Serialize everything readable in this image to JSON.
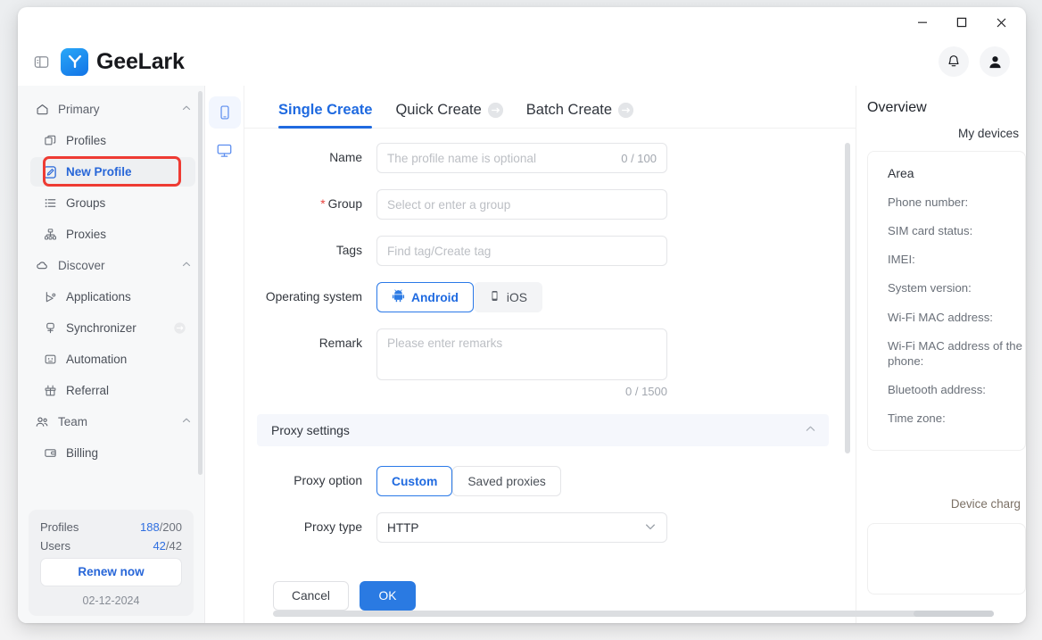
{
  "window": {
    "controls": {
      "minimize": "minimize-icon",
      "maximize": "maximize-icon",
      "close": "close-icon"
    }
  },
  "header": {
    "panel_toggle": "panel-toggle-icon",
    "brand_name": "GeeLark",
    "notification_icon": "bell-icon",
    "account_icon": "user-avatar-icon"
  },
  "sidebar": {
    "groups": [
      {
        "label": "Primary",
        "icon": "home-icon",
        "items": [
          {
            "label": "Profiles",
            "icon": "profiles-icon",
            "active": false
          },
          {
            "label": "New Profile",
            "icon": "edit-square-icon",
            "active": true
          },
          {
            "label": "Groups",
            "icon": "list-icon",
            "active": false
          },
          {
            "label": "Proxies",
            "icon": "network-icon",
            "active": false
          }
        ]
      },
      {
        "label": "Discover",
        "icon": "cloud-icon",
        "items": [
          {
            "label": "Applications",
            "icon": "apps-icon",
            "active": false
          },
          {
            "label": "Synchronizer",
            "icon": "sync-icon",
            "active": false,
            "badge": "link-badge-icon"
          },
          {
            "label": "Automation",
            "icon": "automation-icon",
            "active": false
          },
          {
            "label": "Referral",
            "icon": "gift-icon",
            "active": false
          }
        ]
      },
      {
        "label": "Team",
        "icon": "team-icon",
        "items": [
          {
            "label": "Billing",
            "icon": "billing-icon",
            "active": false
          }
        ]
      }
    ],
    "quota": {
      "profiles_label": "Profiles",
      "profiles_used": "188",
      "profiles_total": "/200",
      "users_label": "Users",
      "users_used": "42",
      "users_total": "/42",
      "renew_label": "Renew now",
      "date": "02-12-2024"
    }
  },
  "rail": {
    "items": [
      {
        "icon": "phone-icon",
        "active": true
      },
      {
        "icon": "monitor-icon",
        "active": false
      }
    ]
  },
  "main": {
    "tabs": [
      {
        "label": "Single Create",
        "active": true,
        "badge": null
      },
      {
        "label": "Quick Create",
        "active": false,
        "badge": "link-badge-icon"
      },
      {
        "label": "Batch Create",
        "active": false,
        "badge": "link-badge-icon"
      }
    ],
    "form": {
      "name": {
        "label": "Name",
        "placeholder": "The profile name is optional",
        "value": "",
        "counter": "0 / 100"
      },
      "group": {
        "label": "Group",
        "required": true,
        "placeholder": "Select or enter a group",
        "value": ""
      },
      "tags": {
        "label": "Tags",
        "placeholder": "Find tag/Create tag",
        "value": ""
      },
      "operating_system": {
        "label": "Operating system",
        "options": [
          {
            "label": "Android",
            "icon": "android-icon",
            "selected": true
          },
          {
            "label": "iOS",
            "icon": "ios-phone-icon",
            "selected": false
          }
        ]
      },
      "remark": {
        "label": "Remark",
        "placeholder": "Please enter remarks",
        "value": "",
        "counter": "0 / 1500"
      }
    },
    "proxy_section": {
      "title": "Proxy settings",
      "collapse_icon": "chevron-up-icon",
      "proxy_option": {
        "label": "Proxy option",
        "options": [
          {
            "label": "Custom",
            "selected": true
          },
          {
            "label": "Saved proxies",
            "selected": false
          }
        ]
      },
      "proxy_type": {
        "label": "Proxy type",
        "value": "HTTP",
        "caret": "chevron-down-icon"
      }
    },
    "footer": {
      "cancel_label": "Cancel",
      "ok_label": "OK"
    }
  },
  "overview": {
    "title": "Overview",
    "subtitle": "My devices",
    "card": {
      "heading": "Area",
      "fields": [
        "Phone number:",
        "SIM card status:",
        "IMEI:",
        "System version:",
        "Wi-Fi MAC address:",
        "Wi-Fi MAC address of the phone:",
        "Bluetooth address:",
        "Time zone:"
      ]
    },
    "note": "Device charg"
  },
  "colors": {
    "accent": "#2a7ae2",
    "highlight": "#ee3b33",
    "required": "#e8413c",
    "sidebar_bg": "#f7f8f9"
  }
}
